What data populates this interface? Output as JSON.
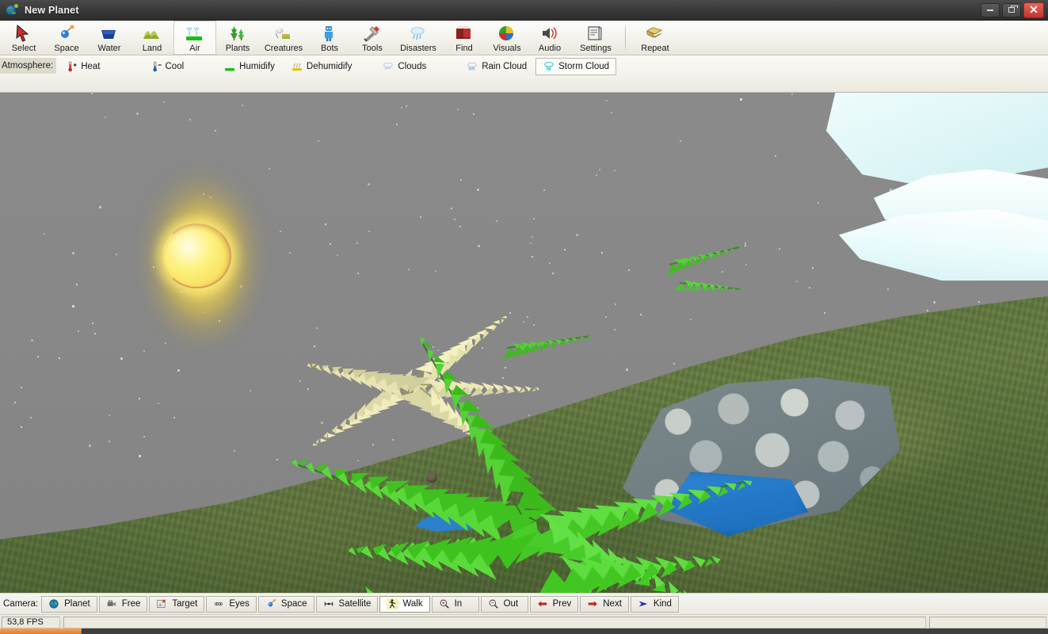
{
  "window": {
    "title": "New Planet",
    "icon": "globe-icon",
    "controls": {
      "minimize": "minimize-button",
      "restore": "restore-button",
      "close": "close-button"
    }
  },
  "toolbar": {
    "items": [
      {
        "label": "Select",
        "icon": "cursor-arrow-icon",
        "selected": false
      },
      {
        "label": "Space",
        "icon": "satellite-icon",
        "selected": false
      },
      {
        "label": "Water",
        "icon": "water-basin-icon",
        "selected": false
      },
      {
        "label": "Land",
        "icon": "hills-icon",
        "selected": false
      },
      {
        "label": "Air",
        "icon": "air-sprinkler-icon",
        "selected": true
      },
      {
        "label": "Plants",
        "icon": "trees-icon",
        "selected": false
      },
      {
        "label": "Creatures",
        "icon": "creature-icon",
        "selected": false
      },
      {
        "label": "Bots",
        "icon": "robot-icon",
        "selected": false
      },
      {
        "label": "Tools",
        "icon": "tools-icon",
        "selected": false
      },
      {
        "label": "Disasters",
        "icon": "storm-icon",
        "selected": false
      },
      {
        "label": "Find",
        "icon": "book-icon",
        "selected": false
      },
      {
        "label": "Visuals",
        "icon": "color-sphere-icon",
        "selected": false
      },
      {
        "label": "Audio",
        "icon": "speaker-icon",
        "selected": false
      },
      {
        "label": "Settings",
        "icon": "settings-book-icon",
        "selected": false
      }
    ],
    "trailing": [
      {
        "label": "Repeat",
        "icon": "layers-copy-icon",
        "selected": false
      }
    ]
  },
  "subbar": {
    "group_label": "Atmosphere:",
    "items": [
      {
        "label": "Heat",
        "icon": "thermometer-plus-icon",
        "selected": false
      },
      {
        "label": "Cool",
        "icon": "thermometer-minus-icon",
        "selected": false
      },
      {
        "label": "Humidify",
        "icon": "humidify-icon",
        "selected": false
      },
      {
        "label": "Dehumidify",
        "icon": "dehumidify-icon",
        "selected": false
      },
      {
        "label": "Clouds",
        "icon": "cloud-icon",
        "selected": false
      },
      {
        "label": "Rain Cloud",
        "icon": "rain-cloud-icon",
        "selected": false
      },
      {
        "label": "Storm Cloud",
        "icon": "storm-cloud-icon",
        "selected": true
      }
    ]
  },
  "camerabar": {
    "group_label": "Camera:",
    "items": [
      {
        "label": "Planet",
        "icon": "globe-icon",
        "active": false
      },
      {
        "label": "Free",
        "icon": "video-camera-icon",
        "active": false
      },
      {
        "label": "Target",
        "icon": "target-photo-icon",
        "active": false
      },
      {
        "label": "Eyes",
        "icon": "eyes-icon",
        "active": false
      },
      {
        "label": "Space",
        "icon": "satellite-icon",
        "active": false
      },
      {
        "label": "Satellite",
        "icon": "antenna-icon",
        "active": false
      },
      {
        "label": "Walk",
        "icon": "walking-man-icon",
        "active": true
      },
      {
        "label": "In",
        "icon": "zoom-in-icon",
        "active": false
      },
      {
        "label": "Out",
        "icon": "zoom-out-icon",
        "active": false
      },
      {
        "label": "Prev",
        "icon": "arrow-left-icon",
        "active": false
      },
      {
        "label": "Next",
        "icon": "arrow-right-icon",
        "active": false
      },
      {
        "label": "Kind",
        "icon": "arrow-kind-icon",
        "active": false
      }
    ]
  },
  "statusbar": {
    "fps": "53,8 FPS",
    "middle": "",
    "right": ""
  },
  "scene": {
    "description": "low-poly 3D planet surface at dusk",
    "sky_color": "#878787",
    "sun": {
      "name": "sun",
      "glow_color": "#ffe860",
      "disc_color": "#fdf27f"
    },
    "cloud": {
      "name": "storm-cloud-formation",
      "color": "#e8fafb"
    },
    "terrain": {
      "name": "grass-hill",
      "color": "#5c7140"
    },
    "water": {
      "name": "water-pool",
      "color": "#2277c6"
    },
    "rocks": {
      "name": "rock-pool-rim",
      "color": "#7d8a8c"
    },
    "plants": [
      {
        "name": "fern-pale",
        "color": "#dfdcae"
      },
      {
        "name": "fern-green",
        "color": "#4ec62e"
      },
      {
        "name": "fern-distant",
        "color": "#49c62b"
      }
    ]
  }
}
